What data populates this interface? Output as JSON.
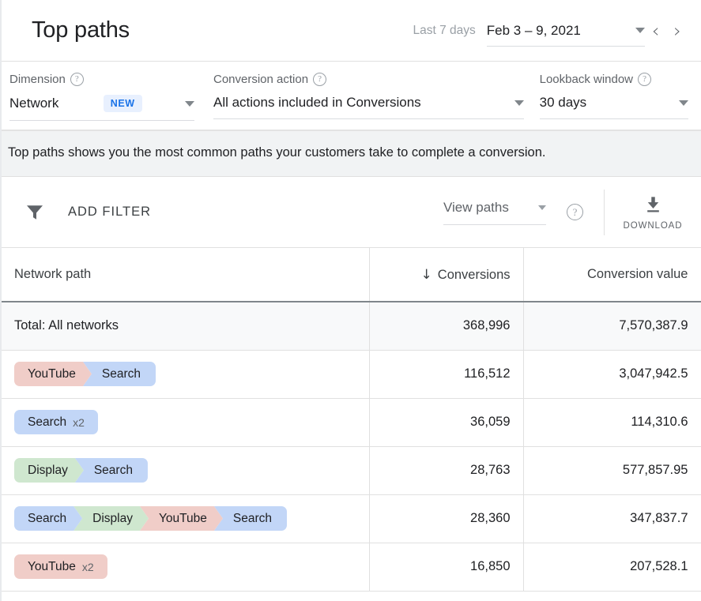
{
  "header": {
    "title": "Top paths",
    "date_preset": "Last 7 days",
    "date_range": "Feb 3 – 9, 2021",
    "prev_arrow": "‹",
    "next_arrow": "›"
  },
  "controls": {
    "dimension": {
      "label": "Dimension",
      "value": "Network",
      "badge": "NEW",
      "help": "?"
    },
    "conversion_action": {
      "label": "Conversion action",
      "value": "All actions included in Conversions",
      "help": "?"
    },
    "lookback_window": {
      "label": "Lookback window",
      "value": "30 days",
      "help": "?"
    }
  },
  "banner": {
    "text": "Top paths shows you the most common paths your customers take to complete a conversion."
  },
  "toolbar": {
    "add_filter_label": "ADD FILTER",
    "view_paths_label": "View paths",
    "view_paths_help": "?",
    "download_label": "DOWNLOAD"
  },
  "table": {
    "columns": {
      "path": "Network path",
      "conversions": "Conversions",
      "conversion_value": "Conversion value",
      "sort_indicator": "↓"
    },
    "rows": [
      {
        "total_label": "Total: All networks",
        "is_total": true,
        "chips": [],
        "conversions": "368,996",
        "conversion_value": "7,570,387.9"
      },
      {
        "is_total": false,
        "chips": [
          {
            "label": "YouTube",
            "color": "#f0cdc8",
            "repeat": ""
          },
          {
            "label": "Search",
            "color": "#c2d6f7",
            "repeat": ""
          }
        ],
        "conversions": "116,512",
        "conversion_value": "3,047,942.5"
      },
      {
        "is_total": false,
        "chips": [
          {
            "label": "Search",
            "color": "#c2d6f7",
            "repeat": "x2"
          }
        ],
        "conversions": "36,059",
        "conversion_value": "114,310.6"
      },
      {
        "is_total": false,
        "chips": [
          {
            "label": "Display",
            "color": "#cfe7cf",
            "repeat": ""
          },
          {
            "label": "Search",
            "color": "#c2d6f7",
            "repeat": ""
          }
        ],
        "conversions": "28,763",
        "conversion_value": "577,857.95"
      },
      {
        "is_total": false,
        "chips": [
          {
            "label": "Search",
            "color": "#c2d6f7",
            "repeat": ""
          },
          {
            "label": "Display",
            "color": "#cfe7cf",
            "repeat": ""
          },
          {
            "label": "YouTube",
            "color": "#f0cdc8",
            "repeat": ""
          },
          {
            "label": "Search",
            "color": "#c2d6f7",
            "repeat": ""
          }
        ],
        "conversions": "28,360",
        "conversion_value": "347,837.7"
      },
      {
        "is_total": false,
        "chips": [
          {
            "label": "YouTube",
            "color": "#f0cdc8",
            "repeat": "x2"
          }
        ],
        "conversions": "16,850",
        "conversion_value": "207,528.1"
      }
    ]
  },
  "colors": {
    "accent_blue": "#1a73e8",
    "chip_search": "#c2d6f7",
    "chip_display": "#cfe7cf",
    "chip_youtube": "#f0cdc8",
    "banner_bg": "#f1f3f4",
    "total_row_bg": "#f8f9fa"
  }
}
